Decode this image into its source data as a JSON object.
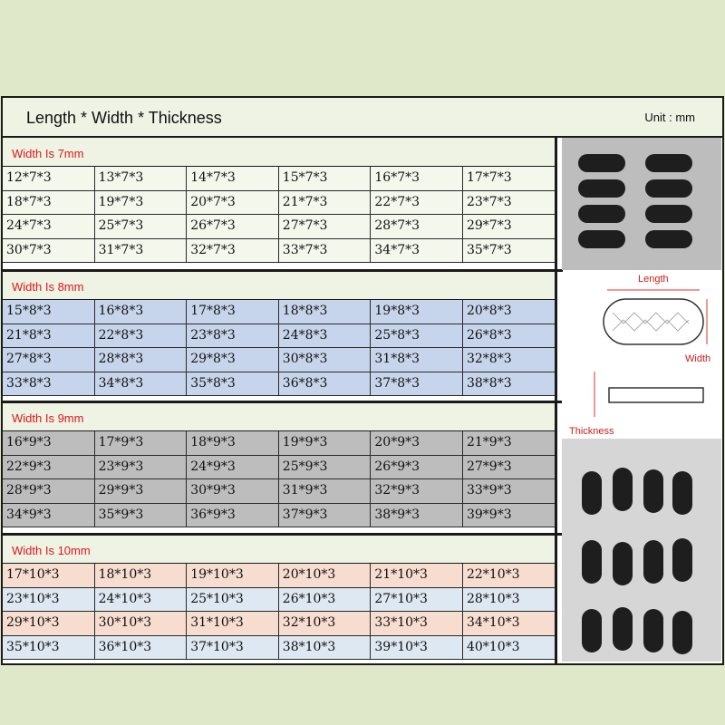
{
  "header": {
    "title": "Length * Width * Thickness",
    "unit": "Unit : mm"
  },
  "sections": [
    {
      "label": "Width Is 7mm",
      "rows": [
        [
          "12*7*3",
          "13*7*3",
          "14*7*3",
          "15*7*3",
          "16*7*3",
          "17*7*3"
        ],
        [
          "18*7*3",
          "19*7*3",
          "20*7*3",
          "21*7*3",
          "22*7*3",
          "23*7*3"
        ],
        [
          "24*7*3",
          "25*7*3",
          "26*7*3",
          "27*7*3",
          "28*7*3",
          "29*7*3"
        ],
        [
          "30*7*3",
          "31*7*3",
          "32*7*3",
          "33*7*3",
          "34*7*3",
          "35*7*3"
        ]
      ]
    },
    {
      "label": "Width Is 8mm",
      "rows": [
        [
          "15*8*3",
          "16*8*3",
          "17*8*3",
          "18*8*3",
          "19*8*3",
          "20*8*3"
        ],
        [
          "21*8*3",
          "22*8*3",
          "23*8*3",
          "24*8*3",
          "25*8*3",
          "26*8*3"
        ],
        [
          "27*8*3",
          "28*8*3",
          "29*8*3",
          "30*8*3",
          "31*8*3",
          "32*8*3"
        ],
        [
          "33*8*3",
          "34*8*3",
          "35*8*3",
          "36*8*3",
          "37*8*3",
          "38*8*3"
        ]
      ]
    },
    {
      "label": "Width Is 9mm",
      "rows": [
        [
          "16*9*3",
          "17*9*3",
          "18*9*3",
          "19*9*3",
          "20*9*3",
          "21*9*3"
        ],
        [
          "22*9*3",
          "23*9*3",
          "24*9*3",
          "25*9*3",
          "26*9*3",
          "27*9*3"
        ],
        [
          "28*9*3",
          "29*9*3",
          "30*9*3",
          "31*9*3",
          "32*9*3",
          "33*9*3"
        ],
        [
          "34*9*3",
          "35*9*3",
          "36*9*3",
          "37*9*3",
          "38*9*3",
          "39*9*3"
        ]
      ]
    },
    {
      "label": "Width Is 10mm",
      "rows": [
        [
          "17*10*3",
          "18*10*3",
          "19*10*3",
          "20*10*3",
          "21*10*3",
          "22*10*3"
        ],
        [
          "23*10*3",
          "24*10*3",
          "25*10*3",
          "26*10*3",
          "27*10*3",
          "28*10*3"
        ],
        [
          "29*10*3",
          "30*10*3",
          "31*10*3",
          "32*10*3",
          "33*10*3",
          "34*10*3"
        ],
        [
          "35*10*3",
          "36*10*3",
          "37*10*3",
          "38*10*3",
          "39*10*3",
          "40*10*3"
        ]
      ]
    }
  ],
  "diagram": {
    "length_label": "Length",
    "width_label": "Width",
    "thickness_label": "Thickness"
  },
  "colors": {
    "page_bg": "#dfe8c8",
    "label_red": "#e0161b",
    "sec0_label_bg": "#eef3e3",
    "sec0_row_bg": "#f4f7ec",
    "sec1_label_bg": "#eef3e3",
    "sec1_row_bg": "#c7d5ec",
    "sec2_label_bg": "#eef3e3",
    "sec2_row_bg": "#bdbdbd",
    "sec3_label_bg": "#eef3e3",
    "sec3_row_a": "#f7dcd0",
    "sec3_row_b": "#dde8f3"
  }
}
